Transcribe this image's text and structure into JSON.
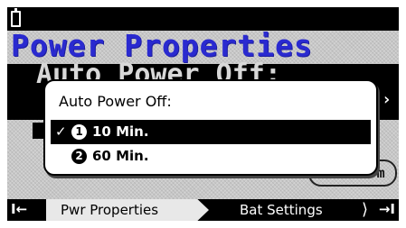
{
  "screen": {
    "title": "Power Properties",
    "selected_row_label": "Auto Power Off:",
    "confirm_label": "Confirm"
  },
  "popup": {
    "title": "Auto Power Off:",
    "options": [
      {
        "number": "1",
        "label": "10 Min.",
        "selected": true
      },
      {
        "number": "2",
        "label": "60 Min.",
        "selected": false
      }
    ]
  },
  "tabs": {
    "prev": "I←",
    "items": [
      "Pwr Properties",
      "Bat Settings"
    ],
    "next": "→I"
  },
  "colors": {
    "title": "#2a2ad0",
    "screen_bg": "#c8c8c8",
    "bar": "#000000"
  }
}
